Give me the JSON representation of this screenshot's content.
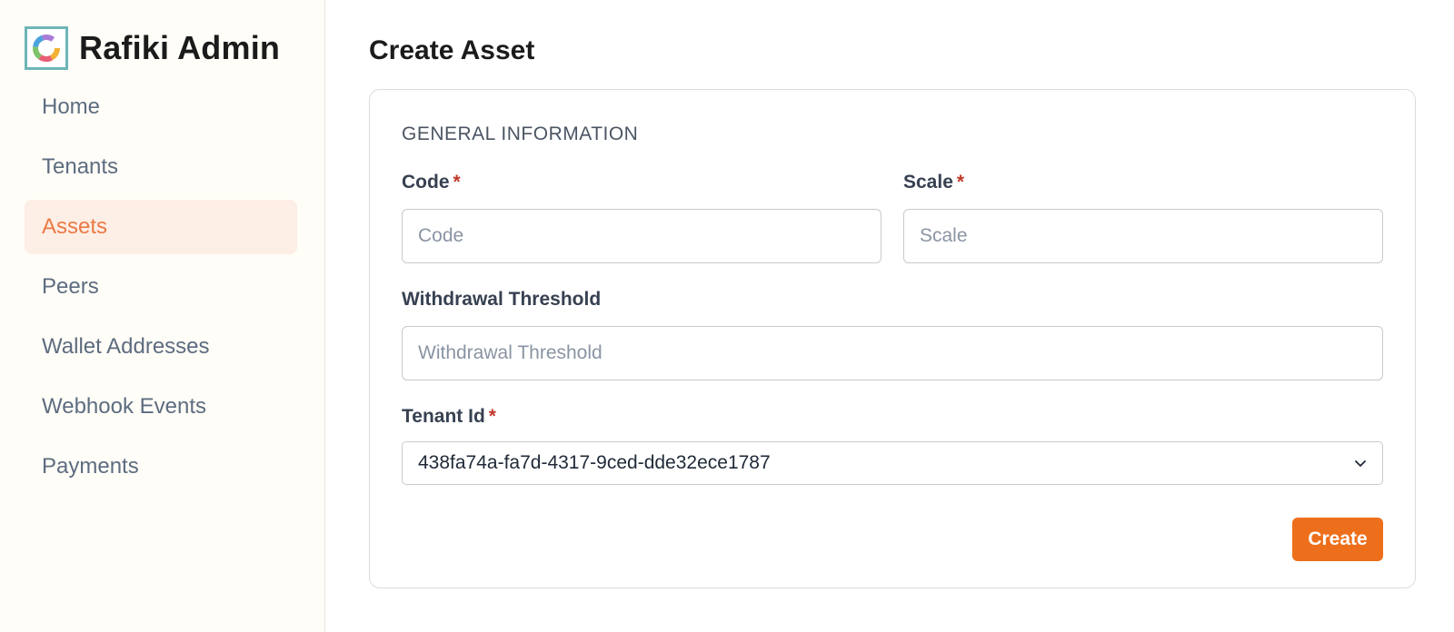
{
  "app": {
    "title": "Rafiki Admin",
    "logo_icon": "rafiki-logo-icon"
  },
  "sidebar": {
    "items": [
      {
        "label": "Home",
        "active": false
      },
      {
        "label": "Tenants",
        "active": false
      },
      {
        "label": "Assets",
        "active": true
      },
      {
        "label": "Peers",
        "active": false
      },
      {
        "label": "Wallet Addresses",
        "active": false
      },
      {
        "label": "Webhook Events",
        "active": false
      },
      {
        "label": "Payments",
        "active": false
      }
    ]
  },
  "page": {
    "title": "Create Asset"
  },
  "form": {
    "section_title": "GENERAL INFORMATION",
    "required_marker": "*",
    "code": {
      "label": "Code",
      "placeholder": "Code",
      "value": "",
      "required": true
    },
    "scale": {
      "label": "Scale",
      "placeholder": "Scale",
      "value": "",
      "required": true
    },
    "withdrawal_threshold": {
      "label": "Withdrawal Threshold",
      "placeholder": "Withdrawal Threshold",
      "value": "",
      "required": false
    },
    "tenant_id": {
      "label": "Tenant Id",
      "selected": "438fa74a-fa7d-4317-9ced-dde32ece1787",
      "required": true,
      "icon": "chevron-down-icon"
    },
    "submit_label": "Create"
  },
  "colors": {
    "accent": "#ee6f1b",
    "active_nav_bg": "#fdeee6",
    "active_nav_text": "#ea7a45",
    "required": "#c0392b",
    "logo_border": "#6fb5b8"
  }
}
